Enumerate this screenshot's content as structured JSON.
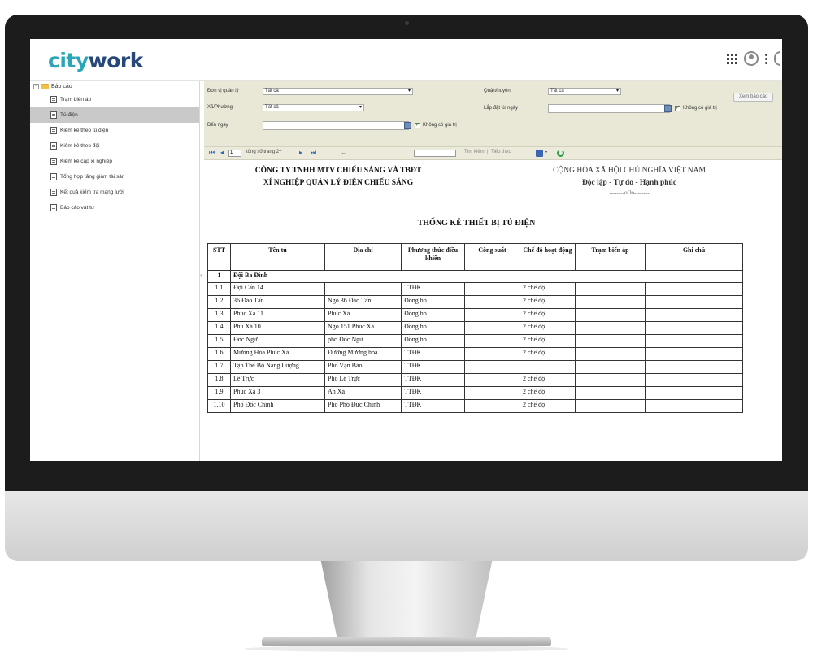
{
  "app": {
    "logo_prefix": "city",
    "logo_suffix": "work"
  },
  "sidebar": {
    "root_label": "Báo cáo",
    "items": [
      {
        "label": "Trạm biến áp",
        "active": false
      },
      {
        "label": "Tủ điện",
        "active": true
      },
      {
        "label": "Kiểm kê theo tủ điện",
        "active": false
      },
      {
        "label": "Kiểm kê theo đội",
        "active": false
      },
      {
        "label": "Kiểm kê cấp xí nghiệp",
        "active": false
      },
      {
        "label": "Tổng hợp tăng giảm tài sản",
        "active": false
      },
      {
        "label": "Kết quả kiểm tra mạng lưới",
        "active": false
      },
      {
        "label": "Báo cáo vật tư",
        "active": false
      }
    ]
  },
  "filters": {
    "don_vi_label": "Đơn vị quản lý",
    "don_vi_value": "Tất cả",
    "quan_huyen_label": "Quận/huyện",
    "quan_huyen_value": "Tất cả",
    "xa_phuong_label": "Xã/Phường",
    "xa_phuong_value": "Tất cả",
    "lap_dat_label": "Lắp đặt từ ngày",
    "den_ngay_label": "Đến ngày",
    "no_value_label": "Không có giá trị",
    "view_report_button": "Xem báo cáo"
  },
  "toolbar": {
    "page_value": "1",
    "page_total_label": "tổng số trang 2+",
    "find_label": "Tìm kiếm",
    "next_label": "Tiếp theo",
    "separator": "|"
  },
  "report": {
    "company_line1": "CÔNG TY TNHH MTV CHIẾU SÁNG VÀ TBĐT",
    "company_line2": "XÍ NGHIỆP QUẢN LÝ ĐIỆN CHIẾU SÁNG",
    "nation_line1": "CỘNG HÒA XÃ HỘI CHỦ NGHĨA VIỆT NAM",
    "nation_line2": "Độc lập - Tự do - Hạnh phúc",
    "nation_separator": "--------oOo--------",
    "title": "THỐNG KÊ THIẾT BỊ TỦ ĐIỆN",
    "columns": [
      "STT",
      "Tên tủ",
      "Địa chỉ",
      "Phương thức điều khiển",
      "Công suất",
      "Chế độ hoạt động",
      "Trạm biến áp",
      "Ghi chú"
    ],
    "group": {
      "stt": "1",
      "name": "Đội Ba Đình"
    },
    "rows": [
      [
        "1.1",
        "Đội Cấn 14",
        "",
        "TTĐK",
        "",
        "2 chế độ",
        "",
        ""
      ],
      [
        "1.2",
        "36 Đào Tấn",
        "Ngõ 36 Đào Tấn",
        "Đồng hồ",
        "",
        "2 chế độ",
        "",
        ""
      ],
      [
        "1.3",
        "Phúc Xá 11",
        "Phúc Xá",
        "Đồng hồ",
        "",
        "2 chế độ",
        "",
        ""
      ],
      [
        "1.4",
        "Phú Xá 10",
        "Ngõ 151 Phúc Xá",
        "Đồng hồ",
        "",
        "2 chế độ",
        "",
        ""
      ],
      [
        "1.5",
        "Đốc Ngữ",
        "phố Đốc Ngữ",
        "Đồng hồ",
        "",
        "2 chế độ",
        "",
        ""
      ],
      [
        "1.6",
        "Mương Hòa Phúc Xá",
        "Đường Mương hòa",
        "TTĐK",
        "",
        "2 chế độ",
        "",
        ""
      ],
      [
        "1.7",
        "Tập Thể Bộ Năng Lượng",
        "Phố Vạn Bảo",
        "TTĐK",
        "",
        "",
        "",
        ""
      ],
      [
        "1.8",
        "Lê Trực",
        "Phố Lê Trực",
        "TTĐK",
        "",
        "2 chế độ",
        "",
        ""
      ],
      [
        "1.9",
        "Phúc Xá 3",
        "An Xá",
        "TTĐK",
        "",
        "2 chế độ",
        "",
        ""
      ],
      [
        "1.10",
        "Phố Đốc Chính",
        "Phố Phó Đức Chính",
        "TTĐK",
        "",
        "2 chế độ",
        "",
        ""
      ]
    ]
  }
}
